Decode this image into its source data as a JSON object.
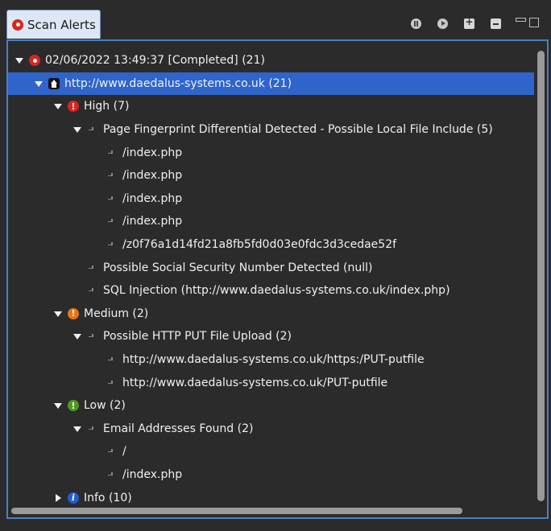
{
  "tab": {
    "label": "Scan Alerts"
  },
  "toolbar": {
    "icons": [
      "pause-icon",
      "resume-icon",
      "expand-all-icon",
      "collapse-all-icon"
    ]
  },
  "colors": {
    "selected": "#2f65ca",
    "high": "#d9261c",
    "medium": "#e9741a",
    "low": "#4f9a1f",
    "info": "#1f5fcf",
    "border": "#4a7fc6"
  },
  "tree": [
    {
      "label": "02/06/2022 13:49:37 [Completed]  (21)",
      "icon": "scan-icon",
      "level": 0,
      "twisty": "down"
    },
    {
      "label": "http://www.daedalus-systems.co.uk (21)",
      "icon": "site-icon",
      "level": 1,
      "twisty": "down",
      "selected": true
    },
    {
      "label": "High (7)",
      "icon": "high-risk-icon",
      "level": 2,
      "twisty": "down"
    },
    {
      "label": "Page Fingerprint Differential Detected - Possible Local File Include (5)",
      "icon": "leaf-icon",
      "level": 3,
      "twisty": "down"
    },
    {
      "label": "/index.php",
      "icon": "leaf-icon",
      "level": 4,
      "twisty": "none"
    },
    {
      "label": "/index.php",
      "icon": "leaf-icon",
      "level": 4,
      "twisty": "none"
    },
    {
      "label": "/index.php",
      "icon": "leaf-icon",
      "level": 4,
      "twisty": "none"
    },
    {
      "label": "/index.php",
      "icon": "leaf-icon",
      "level": 4,
      "twisty": "none"
    },
    {
      "label": "/z0f76a1d14fd21a8fb5fd0d03e0fdc3d3cedae52f",
      "icon": "leaf-icon",
      "level": 4,
      "twisty": "none"
    },
    {
      "label": "Possible Social Security Number Detected (null)",
      "icon": "leaf-icon",
      "level": 3,
      "twisty": "none"
    },
    {
      "label": "SQL Injection (http://www.daedalus-systems.co.uk/index.php)",
      "icon": "leaf-icon",
      "level": 3,
      "twisty": "none"
    },
    {
      "label": "Medium (2)",
      "icon": "medium-risk-icon",
      "level": 2,
      "twisty": "down"
    },
    {
      "label": "Possible HTTP PUT File Upload (2)",
      "icon": "leaf-icon",
      "level": 3,
      "twisty": "down"
    },
    {
      "label": "http://www.daedalus-systems.co.uk/https:/PUT-putfile",
      "icon": "leaf-icon",
      "level": 4,
      "twisty": "none"
    },
    {
      "label": "http://www.daedalus-systems.co.uk/PUT-putfile",
      "icon": "leaf-icon",
      "level": 4,
      "twisty": "none"
    },
    {
      "label": "Low (2)",
      "icon": "low-risk-icon",
      "level": 2,
      "twisty": "down"
    },
    {
      "label": "Email Addresses Found (2)",
      "icon": "leaf-icon",
      "level": 3,
      "twisty": "down"
    },
    {
      "label": "/",
      "icon": "leaf-icon",
      "level": 4,
      "twisty": "none"
    },
    {
      "label": "/index.php",
      "icon": "leaf-icon",
      "level": 4,
      "twisty": "none"
    },
    {
      "label": "Info (10)",
      "icon": "info-icon",
      "level": 2,
      "twisty": "right"
    }
  ]
}
